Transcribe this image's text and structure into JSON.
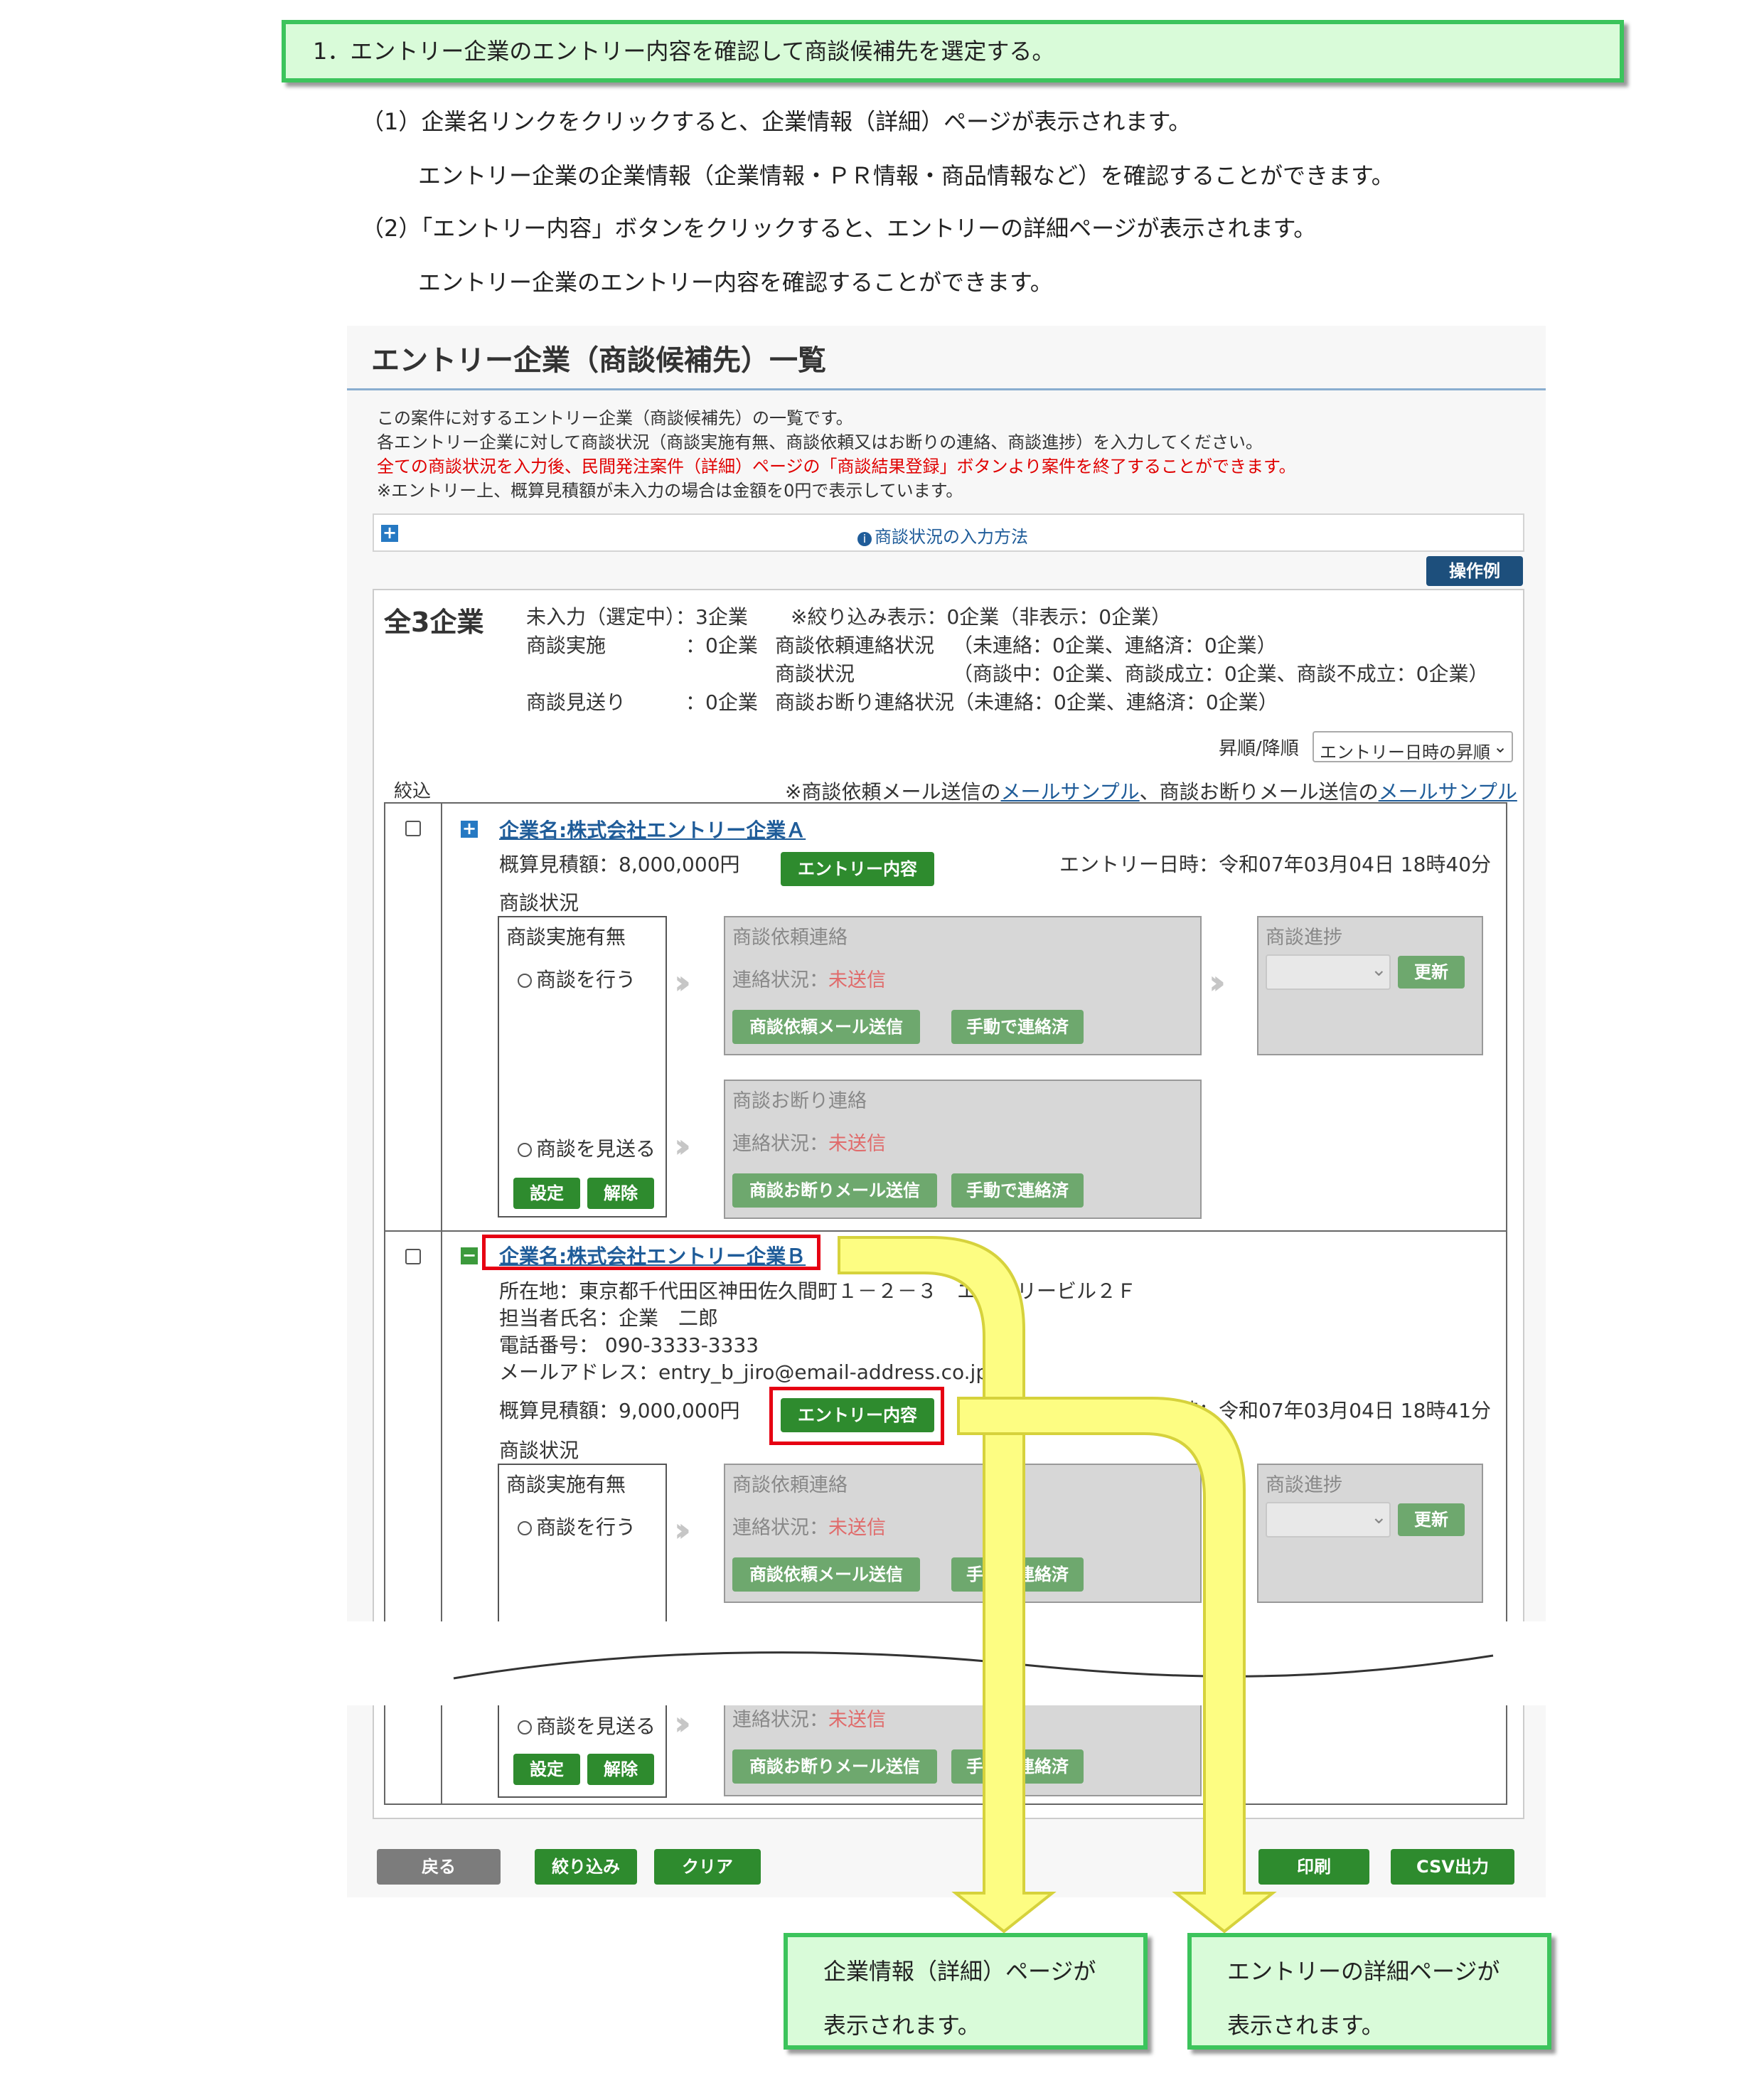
{
  "heading": "1．エントリー企業のエントリー内容を確認して商談候補先を選定する。",
  "instructions": [
    "（1）企業名リンクをクリックすると、企業情報（詳細）ページが表示されます。",
    "エントリー企業の企業情報（企業情報・ＰＲ情報・商品情報など）を確認することができます。",
    "（2）「エントリー内容」ボタンをクリックすると、エントリーの詳細ページが表示されます。",
    "エントリー企業のエントリー内容を確認することができます。"
  ],
  "panel": {
    "title": "エントリー企業（商談候補先）一覧",
    "desc": [
      "この案件に対するエントリー企業（商談候補先）の一覧です。",
      "各エントリー企業に対して商談状況（商談実施有無、商談依頼又はお断りの連絡、商談進捗）を入力してください。",
      "全ての商談状況を入力後、民間発注案件（詳細）ページの「商談結果登録」ボタンより案件を終了することができます。",
      "※エントリー上、概算見積額が未入力の場合は金額を0円で表示しています。"
    ],
    "howto": "商談状況の入力方法",
    "example_btn": "操作例"
  },
  "summary": {
    "total": "全3企業",
    "r1a": "未入力（選定中）：3企業",
    "r1b": "※絞り込み表示：0企業（非表示：0企業）",
    "r2a": "商談実施",
    "r2b": "：0企業",
    "r2c": "商談依頼連絡状況",
    "r2d": "（未連絡：0企業、連絡済：0企業）",
    "r3a": "商談状況",
    "r3b": "（商談中：0企業、商談成立：0企業、商談不成立：0企業）",
    "r4a": "商談見送り",
    "r4b": "：0企業",
    "r4c": "商談お断り連絡状況（未連絡：0企業、連絡済：0企業）",
    "sort_label": "昇順/降順",
    "sort_value": "エントリー日時の昇順"
  },
  "filter_label": "絞込",
  "mail_note_1": "※商談依頼メール送信の",
  "mail_link": "メールサンプル",
  "mail_note_2": "、商談お断りメール送信の",
  "companyA": {
    "name": "企業名:株式会社エントリー企業Ａ",
    "estimate": "概算見積額：8,000,000円",
    "entry_btn": "エントリー内容",
    "date": "エントリー日時：令和07年03月04日 18時40分"
  },
  "companyB": {
    "name": "企業名:株式会社エントリー企業Ｂ",
    "address": "所在地：東京都千代田区神田佐久間町１－２－３　エントリービル２Ｆ",
    "person": "担当者氏名：企業　二郎",
    "phone": "電話番号： 090-3333-3333",
    "email": "メールアドレス：entry_b_jiro@email-address.co.jp",
    "estimate": "概算見積額：9,000,000円",
    "entry_btn": "エントリー内容",
    "date": "エントリー日時：令和07年03月04日 18時41分"
  },
  "status": {
    "label": "商談状況",
    "impl": "商談実施有無",
    "do": "商談を行う",
    "skip": "商談を見送る",
    "set": "設定",
    "cancel": "解除",
    "req_title": "商談依頼連絡",
    "contact": "連絡状況：",
    "unsent": "未送信",
    "req_mail": "商談依頼メール送信",
    "manual": "手動で連絡済",
    "decline_title": "商談お断り連絡",
    "decline_mail": "商談お断りメール送信",
    "progress": "商談進捗",
    "update": "更新"
  },
  "footer": {
    "back": "戻る",
    "filter": "絞り込み",
    "clear": "クリア",
    "print": "印刷",
    "csv": "CSV出力"
  },
  "callouts": {
    "left": [
      "企業情報（詳細）ページが",
      "表示されます。"
    ],
    "right": [
      "エントリーの詳細ページが",
      "表示されます。"
    ]
  }
}
